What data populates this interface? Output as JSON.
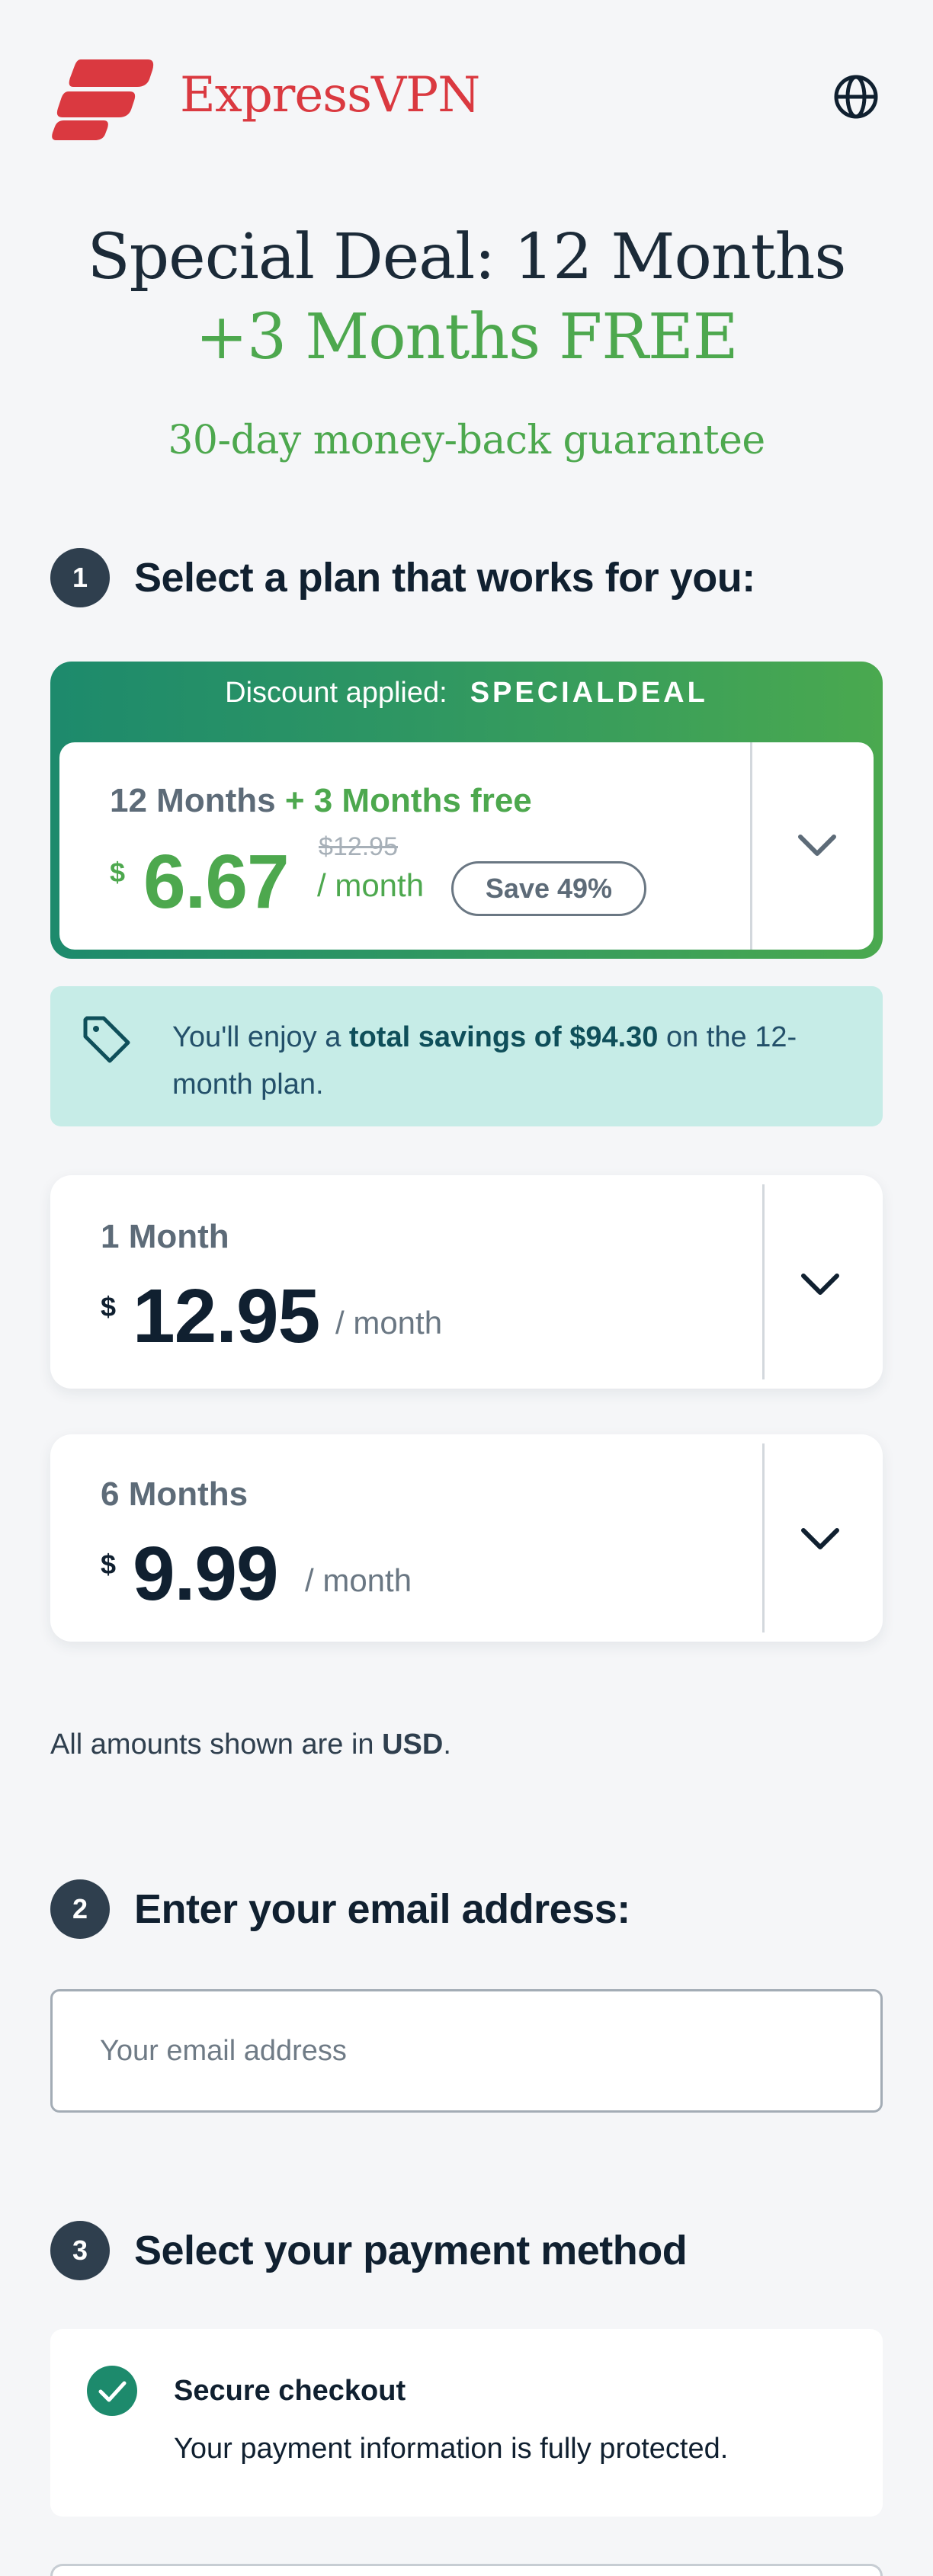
{
  "brand": {
    "name": "ExpressVPN",
    "color": "#da3940"
  },
  "hero": {
    "line1": "Special Deal: 12 Months",
    "line2": "+3 Months FREE",
    "subtitle": "30-day money-back guarantee"
  },
  "steps": {
    "plan": {
      "number": "1",
      "title": "Select a plan that works for you:"
    },
    "email": {
      "number": "2",
      "title": "Enter your email address:"
    },
    "payment": {
      "number": "3",
      "title": "Select your payment method"
    }
  },
  "featured_plan": {
    "discount_label": "Discount applied:",
    "discount_code": "SPECIALDEAL",
    "name": "12 Months",
    "bonus": "+ 3 Months free",
    "currency": "$",
    "price": "6.67",
    "old_price": "$12.95",
    "per": "/ month",
    "save_badge": "Save 49%"
  },
  "savings_banner": {
    "prefix": "You'll enjoy a ",
    "highlight": "total savings of $94.30",
    "suffix": " on the 12-month plan."
  },
  "plans": [
    {
      "name": "1 Month",
      "currency": "$",
      "price": "12.95",
      "per": "/ month"
    },
    {
      "name": "6 Months",
      "currency": "$",
      "price": "9.99",
      "per": "/ month"
    }
  ],
  "currency_note": {
    "prefix": "All amounts shown are in ",
    "currency": "USD",
    "suffix": "."
  },
  "email_input": {
    "placeholder": "Your email address",
    "value": ""
  },
  "secure_checkout": {
    "title": "Secure checkout",
    "description": "Your payment information is fully protected."
  },
  "icons": {
    "language": "globe-icon",
    "expand": "chevron-down-icon",
    "tag": "tag-icon",
    "check": "check-circle-icon"
  },
  "colors": {
    "accent_green": "#4da84e",
    "gradient_start": "#1d8a6c",
    "banner_bg": "#c6ece7",
    "text_dark": "#102030",
    "step_badge": "#2f3f4e"
  }
}
